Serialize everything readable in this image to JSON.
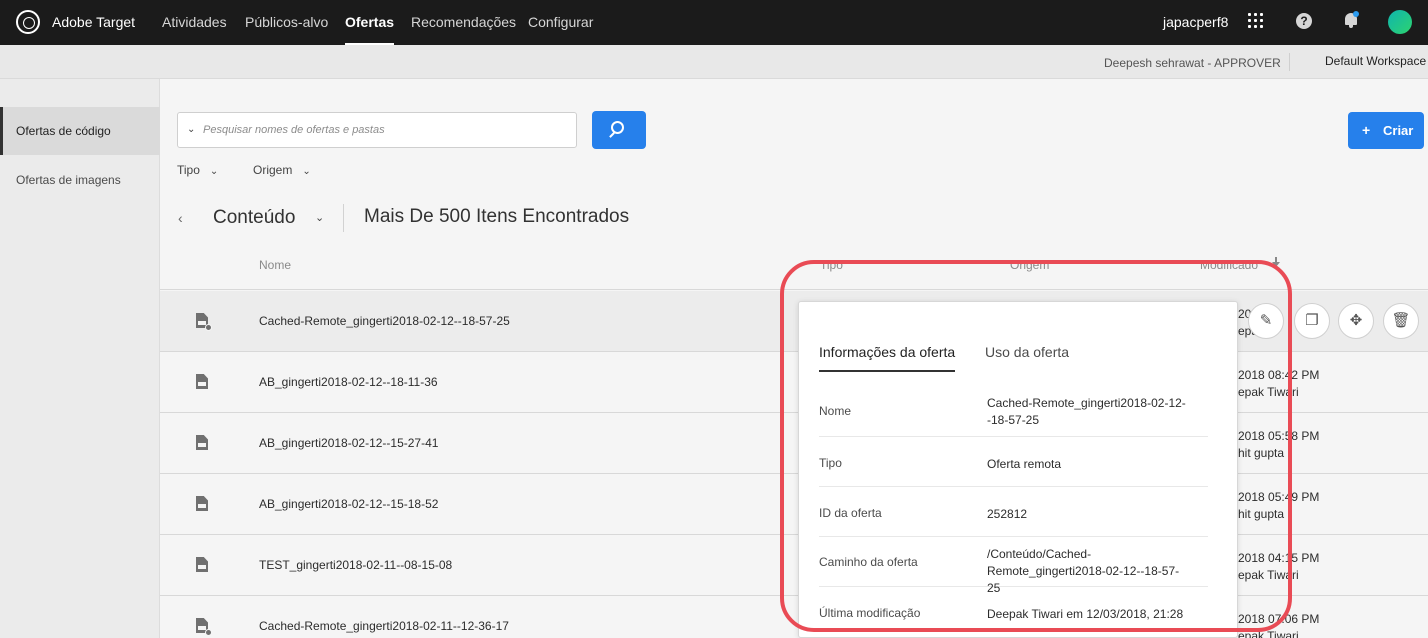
{
  "nav": {
    "brand": "Adobe Target",
    "items": [
      {
        "label": "Atividades",
        "active": false
      },
      {
        "label": "Públicos-alvo",
        "active": false
      },
      {
        "label": "Ofertas",
        "active": true
      },
      {
        "label": "Recomendações",
        "active": false
      },
      {
        "label": "Configurar",
        "active": false
      }
    ],
    "user": "japacperf8"
  },
  "subheader": {
    "approver": "Deepesh sehrawat - APPROVER",
    "workspace": "Default Workspace"
  },
  "sidebar": {
    "items": [
      {
        "label": "Ofertas de código",
        "active": true
      },
      {
        "label": "Ofertas de imagens",
        "active": false
      }
    ]
  },
  "search": {
    "placeholder": "Pesquisar nomes de ofertas e pastas"
  },
  "create_label": "Criar",
  "filters": {
    "type_label": "Tipo",
    "origin_label": "Origem"
  },
  "breadcrumb": {
    "folder": "Conteúdo",
    "count": "Mais De 500 Itens Encontrados"
  },
  "table": {
    "headers": {
      "name": "Nome",
      "type": "Tipo",
      "origin": "Origem",
      "modified": "Modificado"
    },
    "rows": [
      {
        "name": "Cached-Remote_gingerti2018-02-12--18-57-25",
        "date": "2018  08:42 PM",
        "by": "Deepak Tiwari",
        "date_partial": "20",
        "by_partial": "epak",
        "remote": true
      },
      {
        "name": "AB_gingerti2018-02-12--18-11-36",
        "date": "2018  08:42 PM",
        "by": "epak Tiwari",
        "remote": false
      },
      {
        "name": "AB_gingerti2018-02-12--15-27-41",
        "date": "2018  05:58 PM",
        "by": "hit gupta",
        "remote": false
      },
      {
        "name": "AB_gingerti2018-02-12--15-18-52",
        "date": "2018  05:49 PM",
        "by": "hit gupta",
        "remote": false
      },
      {
        "name": "TEST_gingerti2018-02-11--08-15-08",
        "date": "2018  04:15 PM",
        "by": "epak Tiwari",
        "remote": false
      },
      {
        "name": "Cached-Remote_gingerti2018-02-11--12-36-17",
        "date": "2018  07:06 PM",
        "by": "epak Tiwari",
        "remote": true
      }
    ]
  },
  "popover": {
    "tabs": [
      "Informações da oferta",
      "Uso da oferta"
    ],
    "fields": [
      {
        "key": "Nome",
        "value": "Cached-Remote_gingerti2018-02-12--18-57-25"
      },
      {
        "key": "Tipo",
        "value": "Oferta remota"
      },
      {
        "key": "ID da oferta",
        "value": "252812"
      },
      {
        "key": "Caminho da oferta",
        "value": "/Conteúdo/Cached-Remote_gingerti2018-02-12--18-57-25"
      },
      {
        "key": "Última modificação",
        "value": "Deepak Tiwari em 12/03/2018, 21:28"
      }
    ]
  },
  "colors": {
    "accent": "#2680eb",
    "highlight": "#e94b55",
    "topbar": "#1b1b1b"
  },
  "icons": {
    "actions": [
      "edit-icon",
      "copy-icon",
      "move-icon",
      "delete-icon"
    ]
  }
}
